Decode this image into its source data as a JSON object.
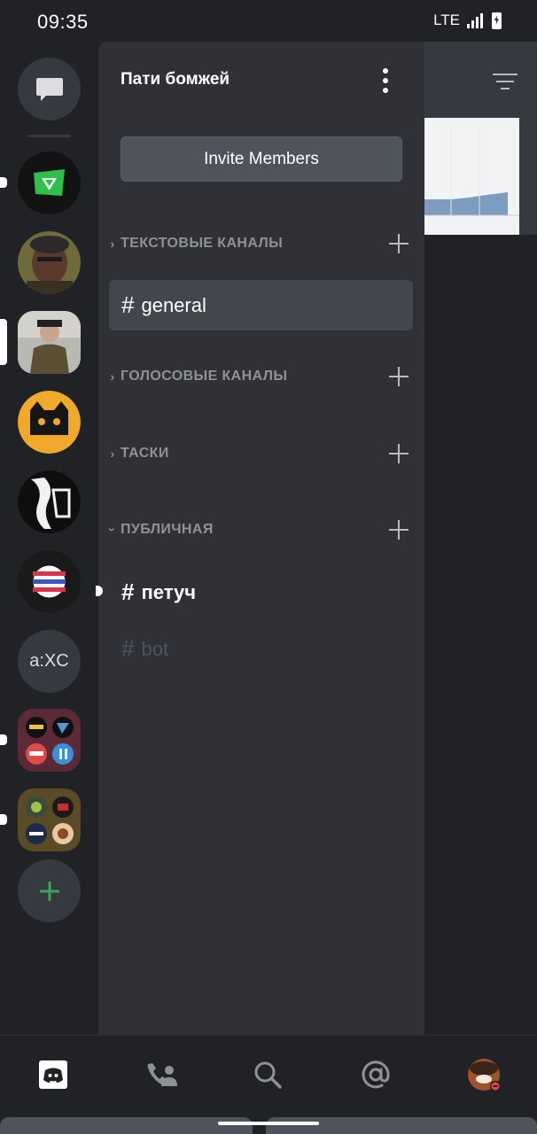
{
  "status_bar": {
    "time": "09:35",
    "network": "LTE"
  },
  "server_rail": {
    "items": [
      {
        "name": "direct-messages",
        "icon": "chat-bubble-icon"
      },
      {
        "name": "server-green-v",
        "icon": "green-v-logo"
      },
      {
        "name": "server-face-avatar",
        "icon": "photo-avatar"
      },
      {
        "name": "server-man-photo",
        "icon": "photo-avatar"
      },
      {
        "name": "server-yellow-mask",
        "icon": "yellow-mask-logo"
      },
      {
        "name": "server-bw-art",
        "icon": "bw-art-logo"
      },
      {
        "name": "server-stripes",
        "icon": "striped-circle-logo"
      },
      {
        "name": "server-axc",
        "acronym": "a:XC"
      },
      {
        "name": "server-folder-1",
        "icon": "folder-icon"
      },
      {
        "name": "server-folder-2",
        "icon": "folder-icon"
      },
      {
        "name": "add-server",
        "icon": "plus-icon"
      }
    ]
  },
  "channel_panel": {
    "server_name": "Пати бомжей",
    "invite_label": "Invite Members",
    "categories": [
      {
        "label": "ТЕКСТОВЫЕ КАНАЛЫ",
        "expanded": false
      },
      {
        "label": "ГОЛОСОВЫЕ КАНАЛЫ",
        "expanded": false
      },
      {
        "label": "ТАСКИ",
        "expanded": false
      },
      {
        "label": "ПУБЛИЧНАЯ",
        "expanded": true
      }
    ],
    "channels": [
      {
        "name": "general",
        "state": "selected"
      },
      {
        "name": "петуч",
        "state": "unread"
      },
      {
        "name": "bot",
        "state": "muted"
      }
    ],
    "hash": "#"
  },
  "colors": {
    "rail_bg": "#202225",
    "panel_bg": "#2f3136",
    "selected_bg": "#42464d",
    "accent_green": "#3ba55d",
    "text_muted": "#8e9297"
  },
  "bottom_nav": {
    "items": [
      "home-icon",
      "friends-icon",
      "search-icon",
      "mentions-icon",
      "profile-avatar"
    ]
  }
}
